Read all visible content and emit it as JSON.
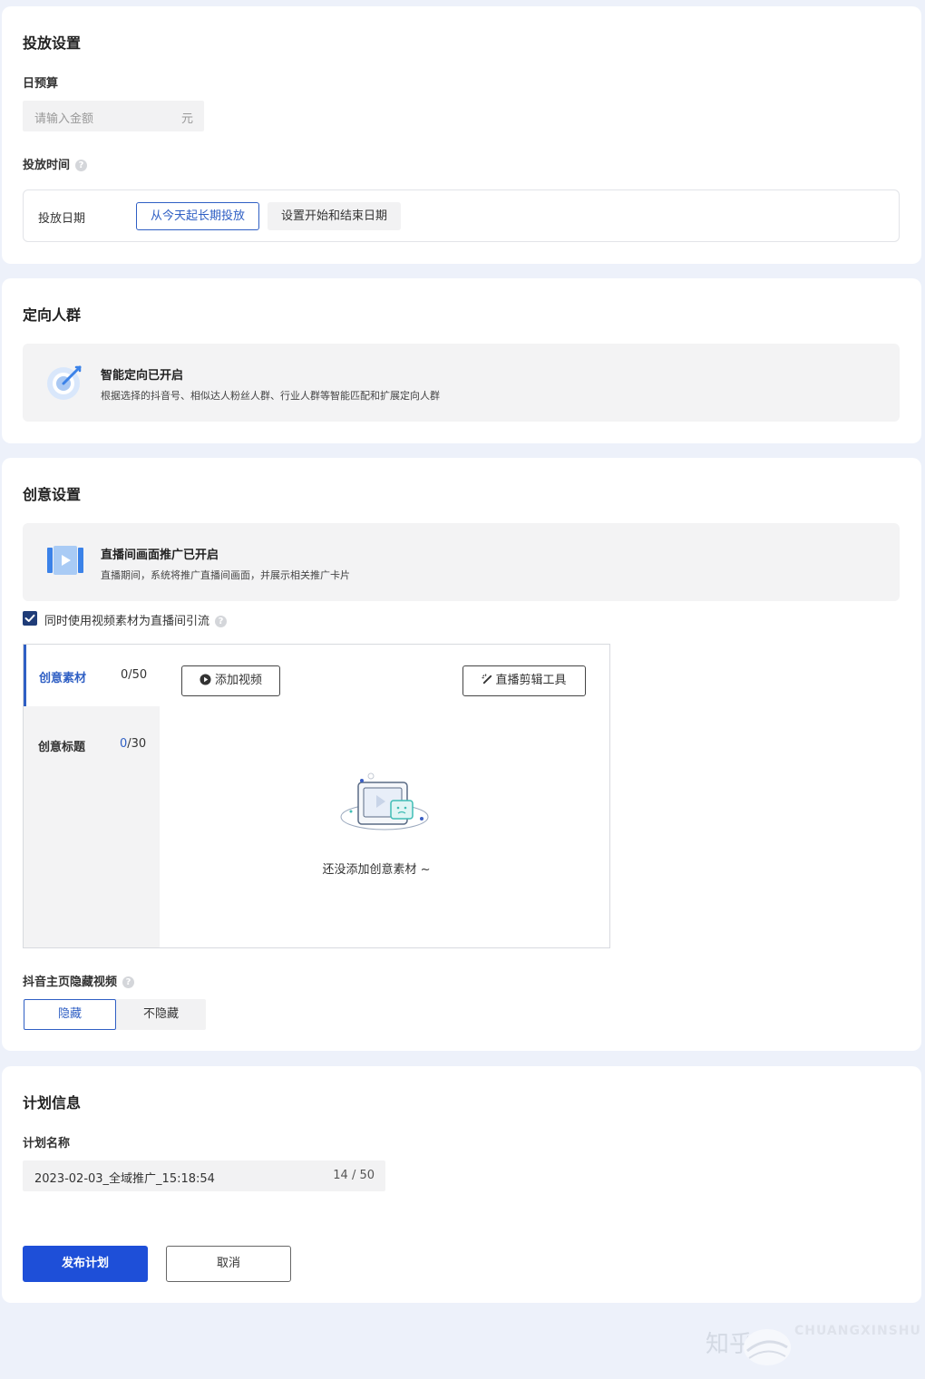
{
  "delivery": {
    "title": "投放设置",
    "budget_label": "日预算",
    "budget_placeholder": "请输入金额",
    "budget_unit": "元",
    "time_label": "投放时间",
    "date_label": "投放日期",
    "date_option_longterm": "从今天起长期投放",
    "date_option_range": "设置开始和结束日期"
  },
  "targeting": {
    "title": "定向人群",
    "banner_title": "智能定向已开启",
    "banner_desc": "根据选择的抖音号、相似达人粉丝人群、行业人群等智能匹配和扩展定向人群"
  },
  "creative": {
    "title": "创意设置",
    "banner_title": "直播间画面推广已开启",
    "banner_desc": "直播期间，系统将推广直播间画面，并展示相关推广卡片",
    "checkbox_label": "同时使用视频素材为直播间引流",
    "tab_material": "创意素材",
    "tab_material_count": "0/50",
    "tab_title": "创意标题",
    "tab_title_count_num": "0",
    "tab_title_count_total": "/30",
    "add_video_button": "添加视频",
    "live_edit_button": "直播剪辑工具",
    "empty_text": "还没添加创意素材 ~",
    "hide_label": "抖音主页隐藏视频",
    "hide_option": "隐藏",
    "show_option": "不隐藏"
  },
  "plan": {
    "title": "计划信息",
    "name_label": "计划名称",
    "name_value": "2023-02-03_全域推广_15:18:54",
    "name_count": "14 / 50"
  },
  "actions": {
    "publish_button": "发布计划",
    "cancel_button": "取消"
  },
  "watermark": {
    "site": "知乎",
    "brand": "CHUANGXINSHU"
  },
  "colors": {
    "accent": "#1e4fd8",
    "selected_border": "#3060c8",
    "page_bg": "#edf1fa"
  }
}
